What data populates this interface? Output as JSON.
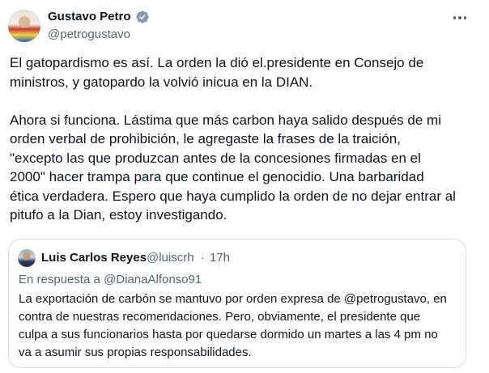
{
  "tweet": {
    "author": {
      "name": "Gustavo Petro",
      "handle": "@petrogustavo",
      "verified_color": "#829aab"
    },
    "text": "El gatopardismo es así. La orden la dió el.presidente en Consejo de\nministros, y gatopardo la volvió inicua en la DIAN.\n\nAhora si funciona. Lástima que más carbon haya salido después de mi\norden verbal de prohibición, le agregaste la frases de la traición,\n\"excepto las que produzcan antes de la concesiones firmadas en el\n2000\" hacer trampa para que continue el genocidio. Una barbaridad\nética verdadera. Espero que haya cumplido la orden de no dejar entrar al\npitufo a la Dian, estoy investigando.",
    "more_icon": "more-horizontal-icon"
  },
  "quoted_tweet": {
    "author": {
      "name": "Luis Carlos Reyes",
      "handle": "@luiscrh",
      "separator": "·",
      "time": "17h"
    },
    "reply_context": "En respuesta a @DianaAlfonso91",
    "text": "La exportación de carbón se mantuvo por orden expresa de @petrogustavo, en\ncontra de nuestras recomendaciones. Pero, obviamente, el presidente que\nculpa a sus funcionarios hasta por quedarse dormido un martes a las 4 pm no\nva a asumir sus propias responsabilidades."
  },
  "colors": {
    "text": "#0f1419",
    "secondary": "#536471",
    "border": "#cfd9de"
  }
}
